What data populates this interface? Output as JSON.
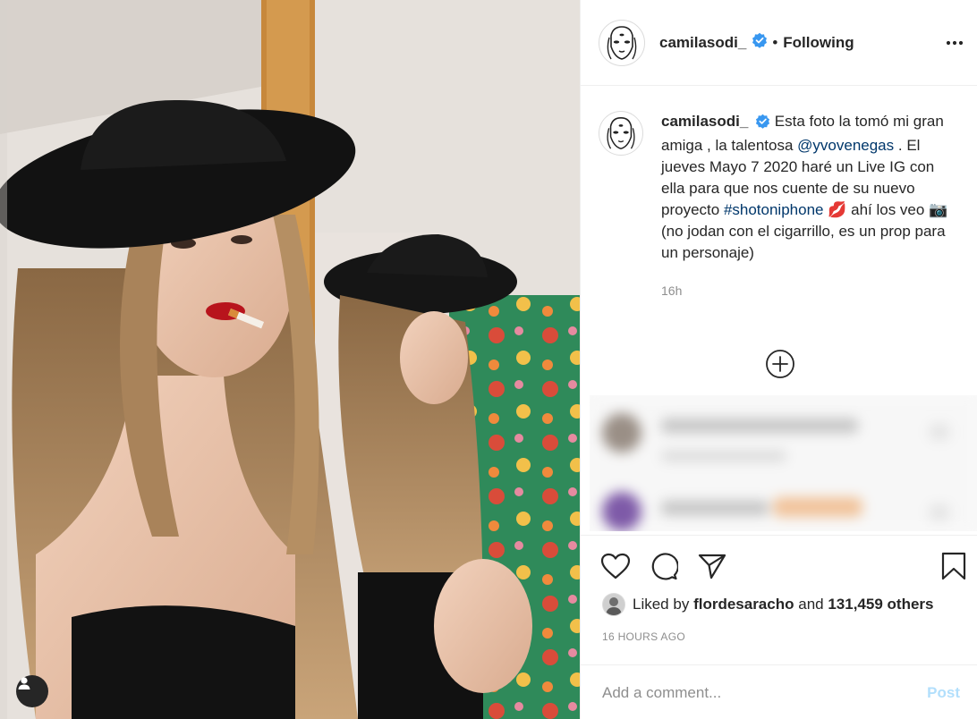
{
  "post": {
    "username": "camilasodi_",
    "following_label": "Following",
    "separator": "•",
    "caption": {
      "username": "camilasodi_",
      "text_1": "Esta foto la tomó mi gran amiga , la talentosa",
      "mention": "@yvovenegas",
      "text_2": ". El jueves Mayo 7 2020 haré un Live IG con ella para que nos cuente de su nuevo proyecto",
      "hashtag": "#shotoniphone",
      "text_3": "ahí los veo",
      "text_4": "(no jodan con el cigarrillo, es un prop para un personaje)",
      "emoji_lips": "💋",
      "emoji_camera": "📷",
      "time": "16h"
    },
    "likes": {
      "prefix": "Liked by",
      "liker": "flordesaracho",
      "connector": "and",
      "others": "131,459 others"
    },
    "timestamp": "16 HOURS AGO",
    "comment": {
      "placeholder": "Add a comment...",
      "post_label": "Post"
    }
  },
  "colors": {
    "verified": "#3897f0",
    "link": "#00376b",
    "post_disabled": "#b2dffc",
    "muted": "#8e8e8e"
  },
  "icons": [
    "user-tag-icon",
    "verified-badge-icon",
    "more-options-icon",
    "load-more-icon",
    "heart-icon",
    "comment-icon",
    "share-icon",
    "bookmark-icon"
  ]
}
